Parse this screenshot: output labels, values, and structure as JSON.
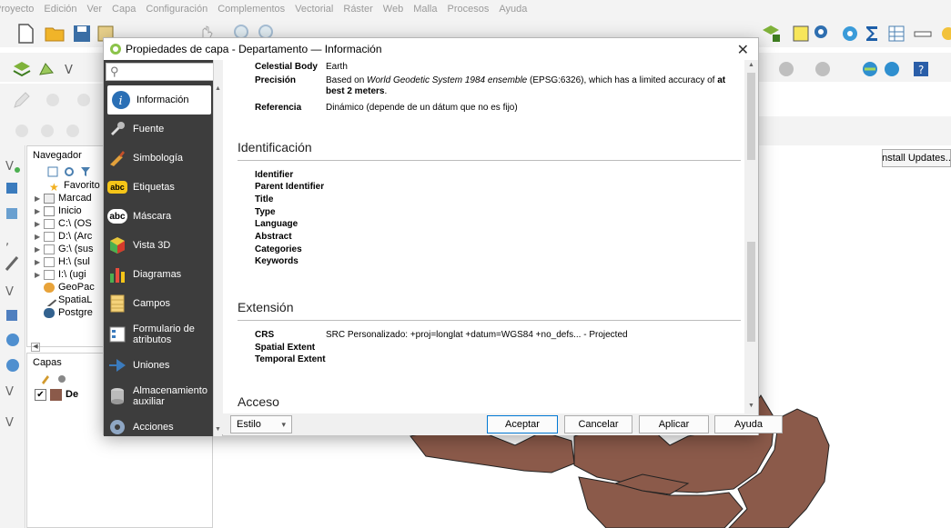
{
  "menu": [
    "Proyecto",
    "Edición",
    "Ver",
    "Capa",
    "Configuración",
    "Complementos",
    "Vectorial",
    "Ráster",
    "Web",
    "Malla",
    "Procesos",
    "Ayuda"
  ],
  "browser_panel": {
    "title": "Navegador",
    "items": [
      "Favorito",
      "Marcad",
      "Inicio",
      "C:\\ (OS",
      "D:\\ (Arc",
      "G:\\ (sus",
      "H:\\ (sul",
      "I:\\ (ugi",
      "GeoPac",
      "SpatiaL",
      "Postgre"
    ]
  },
  "layers_panel": {
    "title": "Capas",
    "layer_label": "De"
  },
  "install_updates": "Install Updates...",
  "dialog": {
    "title": "Propiedades de capa - Departamento — Información",
    "close": "✕",
    "search_glyph": "⚲",
    "nav": [
      {
        "label": "Información"
      },
      {
        "label": "Fuente"
      },
      {
        "label": "Simbología"
      },
      {
        "label": "Etiquetas",
        "badge": "abc"
      },
      {
        "label": "Máscara",
        "badge": "abc"
      },
      {
        "label": "Vista 3D"
      },
      {
        "label": "Diagramas"
      },
      {
        "label": "Campos"
      },
      {
        "label": "Formulario de atributos"
      },
      {
        "label": "Uniones"
      },
      {
        "label": "Almacenamiento auxiliar"
      },
      {
        "label": "Acciones"
      }
    ],
    "crs_rows": [
      {
        "key": "Celestial Body",
        "value": "Earth"
      },
      {
        "key": "Precisión",
        "value_prefix": "Based on ",
        "value_italic": "World Geodetic System 1984 ensemble",
        "value_middle": " (EPSG:6326), which has a limited accuracy of ",
        "value_bold": "at best 2 meters",
        "value_suffix": "."
      },
      {
        "key": "Referencia",
        "value": "Dinámico (depende de un dátum que no es fijo)"
      }
    ],
    "sections": {
      "identification": "Identificación",
      "extension": "Extensión",
      "access": "Acceso"
    },
    "identification_keys": [
      "Identifier",
      "Parent Identifier",
      "Title",
      "Type",
      "Language",
      "Abstract",
      "Categories",
      "Keywords"
    ],
    "extension_rows": [
      {
        "key": "CRS",
        "value": "SRC Personalizado: +proj=longlat +datum=WGS84 +no_defs... - Projected"
      },
      {
        "key": "Spatial Extent",
        "value": ""
      },
      {
        "key": "Temporal Extent",
        "value": ""
      }
    ],
    "footer": {
      "style": "Estilo",
      "style_arrow": "▾",
      "ok": "Aceptar",
      "cancel": "Cancelar",
      "apply": "Aplicar",
      "help": "Ayuda"
    }
  },
  "colors": {
    "nav_bg": "#3d3d3d",
    "map_fill": "#8b5a4a",
    "accent": "#0078d4"
  }
}
